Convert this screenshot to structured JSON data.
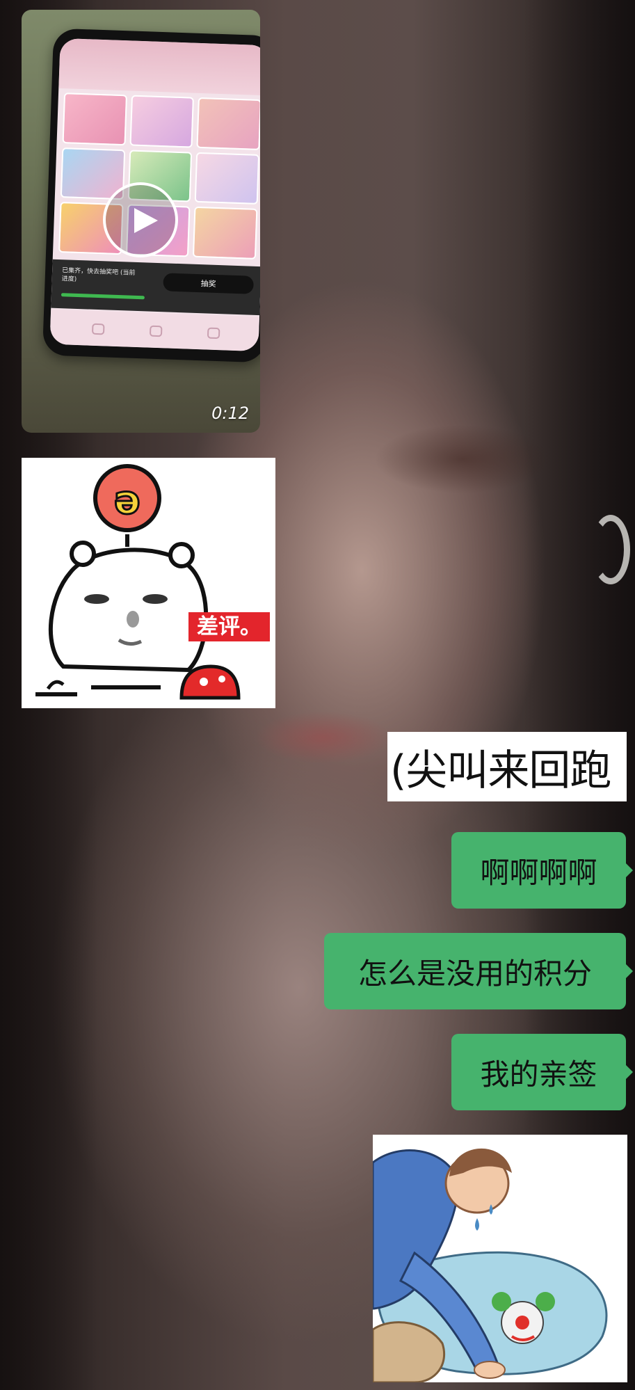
{
  "video_message": {
    "duration": "0:12",
    "thumbnail": {
      "status_text": "已集齐，快去抽奖吧",
      "side_text": "(当前进度)",
      "button_label": "抽奖"
    }
  },
  "sticker_bear": {
    "badge_text": "差评。"
  },
  "sticker_text": {
    "text": "(尖叫来回跑"
  },
  "bubbles": [
    {
      "text": "啊啊啊啊"
    },
    {
      "text": "怎么是没用的积分"
    },
    {
      "text": "我的亲签"
    }
  ],
  "colors": {
    "bubble_green": "#46b36d",
    "badge_red": "#e3252c"
  }
}
